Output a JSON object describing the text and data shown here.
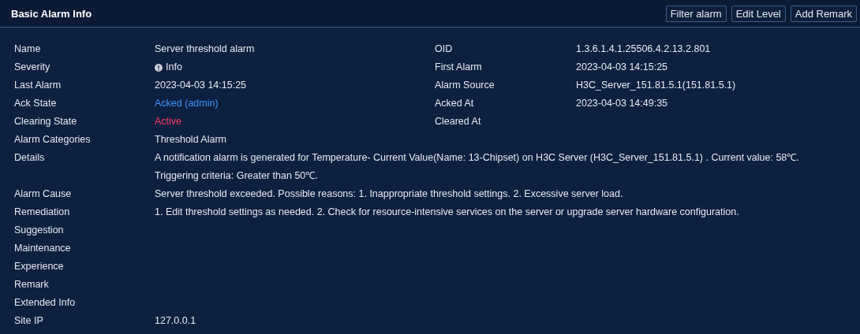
{
  "title": "Basic Alarm Info",
  "buttons": [
    "Filter alarm",
    "Edit Level",
    "Add Remark"
  ],
  "left_fields": [
    {
      "label": "Name",
      "value": "Server threshold alarm"
    },
    {
      "label": "Severity",
      "value": "Info",
      "kind": "severity"
    },
    {
      "label": "Last Alarm",
      "value": "2023-04-03 14:15:25"
    },
    {
      "label": "Ack State",
      "value": "Acked (admin)",
      "kind": "link"
    },
    {
      "label": "Clearing State",
      "value": "Active",
      "kind": "alert"
    },
    {
      "label": "Alarm Categories",
      "value": "Threshold Alarm"
    }
  ],
  "right_fields": [
    {
      "label": "OID",
      "value": "1.3.6.1.4.1.25506.4.2.13.2.801"
    },
    {
      "label": "First Alarm",
      "value": "2023-04-03 14:15:25"
    },
    {
      "label": "Alarm Source",
      "value": "H3C_Server_151.81.5.1(151.81.5.1)"
    },
    {
      "label": "Acked At",
      "value": "2023-04-03 14:49:35"
    },
    {
      "label": "Cleared At"
    }
  ],
  "wide_fields": [
    {
      "label": "Details",
      "lines": [
        "A notification alarm is generated for Temperature- Current Value(Name: 13-Chipset) on H3C Server (H3C_Server_151.81.5.1) . Current value: 58℃.",
        "Triggering criteria:  Greater than 50℃."
      ]
    },
    {
      "label": "Alarm Cause",
      "lines": [
        "Server threshold exceeded. Possible reasons: 1. Inappropriate threshold settings. 2. Excessive server load."
      ]
    },
    {
      "label": "Remediation",
      "lines": [
        "1. Edit threshold settings as needed. 2. Check for resource-intensive services on the server or upgrade server hardware configuration."
      ]
    },
    {
      "label": "Suggestion"
    },
    {
      "label": "Maintenance"
    },
    {
      "label": "Experience"
    },
    {
      "label": "Remark"
    },
    {
      "label": "Extended Info"
    },
    {
      "label": "Site IP",
      "lines": [
        "127.0.0.1"
      ]
    }
  ]
}
